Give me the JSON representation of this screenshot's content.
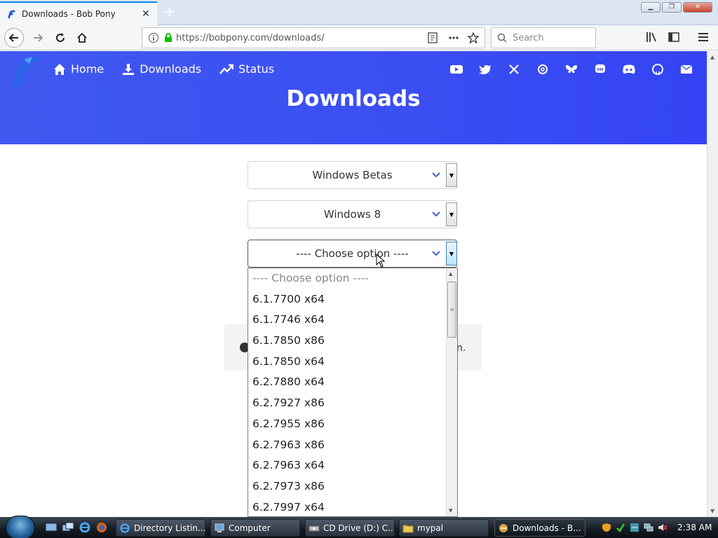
{
  "browser": {
    "tab_title": "Downloads - Bob Pony",
    "tab_close": "✕",
    "new_tab": "+",
    "url": "https://bobpony.com/downloads/",
    "search_placeholder": "Search"
  },
  "site": {
    "nav": [
      {
        "label": "Home",
        "icon": "home-icon"
      },
      {
        "label": "Downloads",
        "icon": "download-icon"
      },
      {
        "label": "Status",
        "icon": "trending-up-icon"
      }
    ],
    "social_icons": [
      "youtube-icon",
      "twitter-icon",
      "x-icon",
      "threads-icon",
      "bluesky-icon",
      "mastodon-icon",
      "discord-icon",
      "github-icon",
      "email-icon"
    ],
    "title": "Downloads",
    "accent_color": "#3a4ef2"
  },
  "selects": {
    "category": "Windows Betas",
    "version": "Windows 8",
    "build": "---- Choose option ----"
  },
  "gray_box_tail": "n.",
  "build_options": [
    "---- Choose option ----",
    "6.1.7700 x64",
    "6.1.7746 x64",
    "6.1.7850 x86",
    "6.1.7850 x64",
    "6.2.7880 x64",
    "6.2.7927 x86",
    "6.2.7955 x86",
    "6.2.7963 x86",
    "6.2.7963 x64",
    "6.2.7973 x86",
    "6.2.7997 x64"
  ],
  "taskbar": {
    "items": [
      {
        "label": "Directory Listin...",
        "icon": "ie-icon"
      },
      {
        "label": "Computer",
        "icon": "computer-icon"
      },
      {
        "label": "CD Drive (D:) C...",
        "icon": "cd-drive-icon"
      },
      {
        "label": "mypal",
        "icon": "folder-icon"
      },
      {
        "label": "Downloads - B...",
        "icon": "mypal-browser-icon"
      }
    ],
    "clock": "2:38 AM"
  }
}
